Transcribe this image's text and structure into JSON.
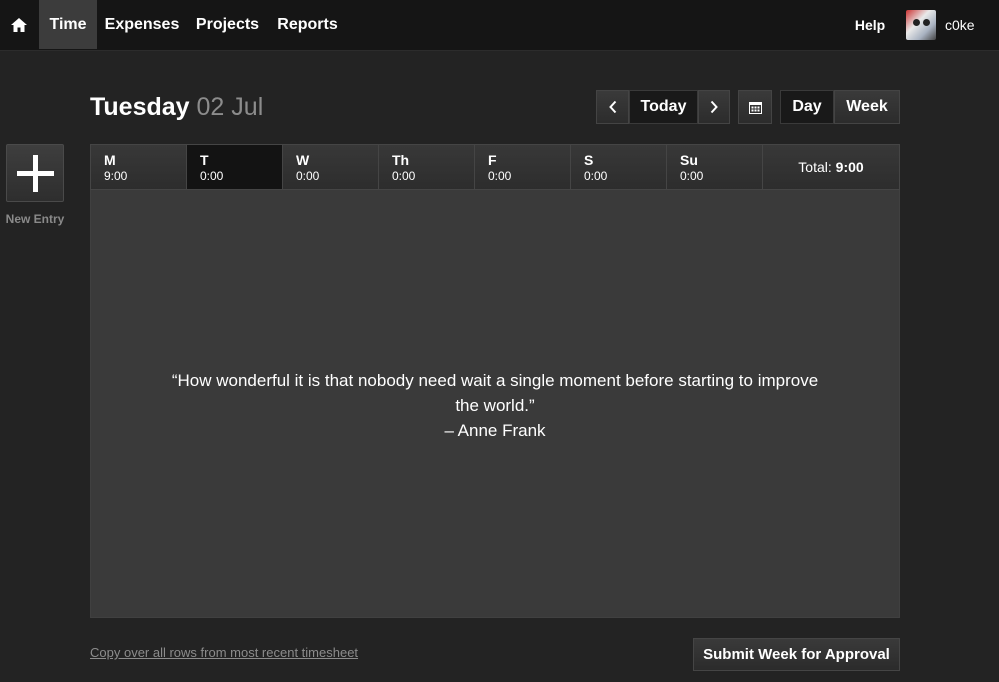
{
  "nav": {
    "tabs": [
      {
        "label": "Time",
        "active": true
      },
      {
        "label": "Expenses"
      },
      {
        "label": "Projects"
      },
      {
        "label": "Reports"
      }
    ],
    "help": "Help",
    "username": "c0ke"
  },
  "sidebar": {
    "new_entry_label": "New Entry"
  },
  "header": {
    "weekday": "Tuesday",
    "date": "02 Jul",
    "today": "Today",
    "day": "Day",
    "week": "Week"
  },
  "week": {
    "days": [
      {
        "abbr": "M",
        "hours": "9:00"
      },
      {
        "abbr": "T",
        "hours": "0:00",
        "selected": true
      },
      {
        "abbr": "W",
        "hours": "0:00"
      },
      {
        "abbr": "Th",
        "hours": "0:00"
      },
      {
        "abbr": "F",
        "hours": "0:00"
      },
      {
        "abbr": "S",
        "hours": "0:00"
      },
      {
        "abbr": "Su",
        "hours": "0:00"
      }
    ],
    "total_label": "Total:",
    "total_value": "9:00"
  },
  "panel": {
    "quote_line1": "“How wonderful it is that nobody need wait a single moment before starting to improve",
    "quote_line2": "the world.”",
    "author": "– Anne Frank"
  },
  "footer": {
    "copy_link": "Copy over all rows from most recent timesheet",
    "submit": "Submit Week for Approval"
  },
  "icons": {
    "home": "home-icon",
    "prev": "chevron-left-icon",
    "next": "chevron-right-icon",
    "calendar": "calendar-icon",
    "plus": "plus-icon"
  }
}
